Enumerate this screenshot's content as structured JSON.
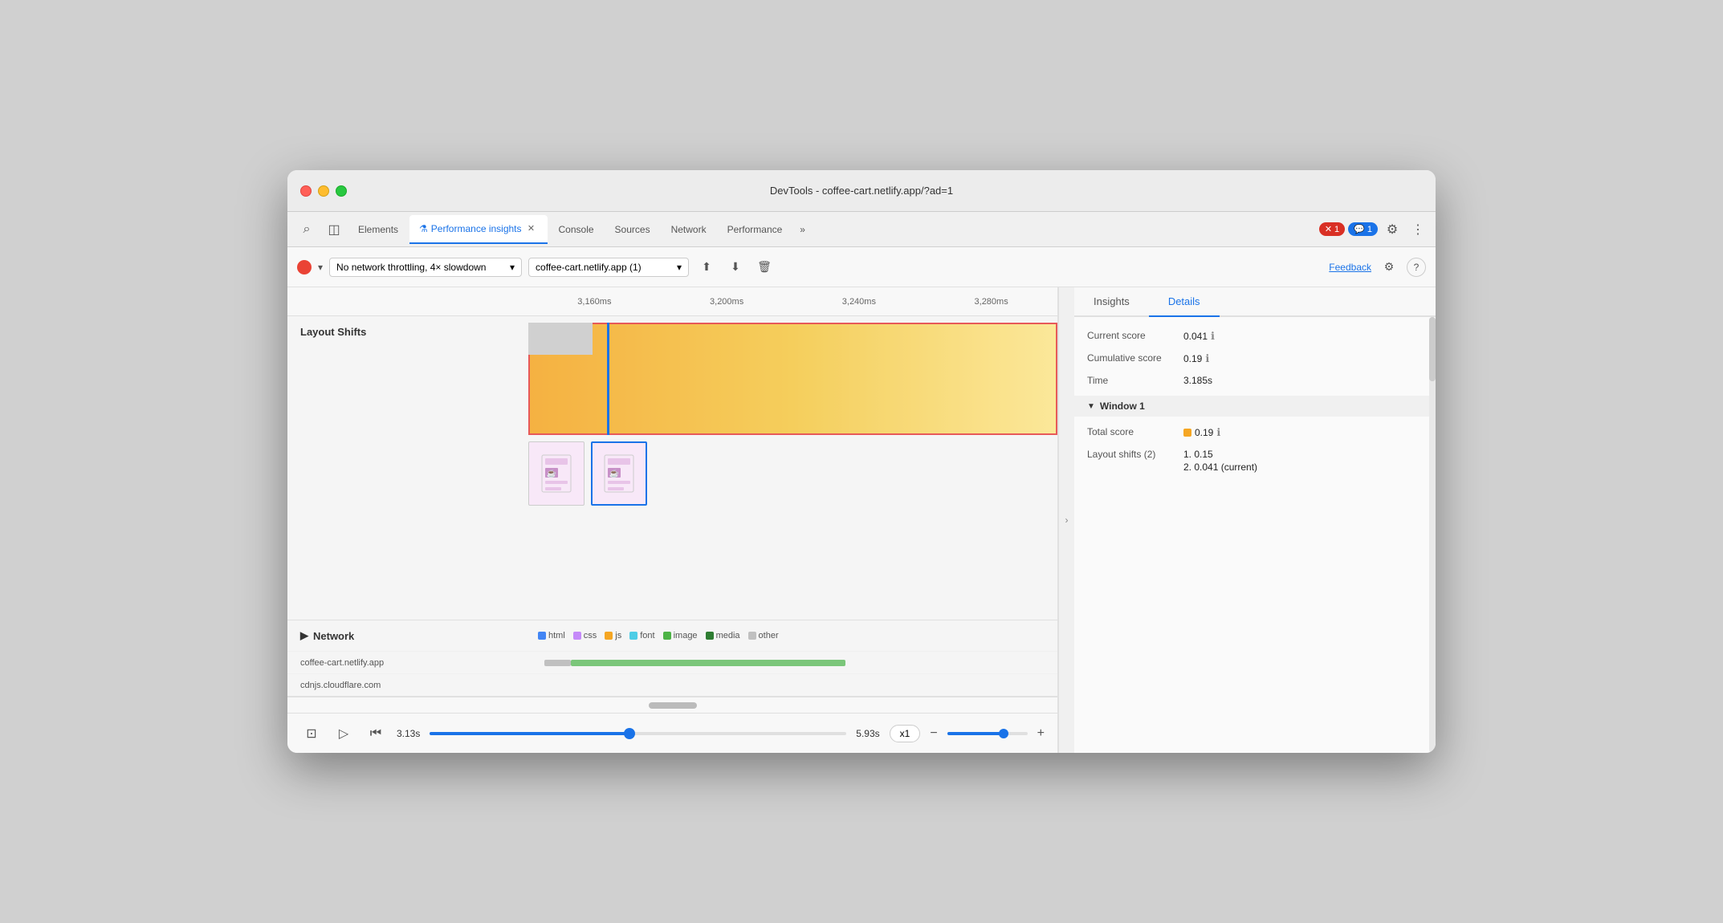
{
  "window": {
    "title": "DevTools - coffee-cart.netlify.app/?ad=1"
  },
  "tabs": {
    "items": [
      {
        "label": "Elements",
        "active": false
      },
      {
        "label": "Performance insights",
        "active": true,
        "icon": "⚗",
        "closeable": true
      },
      {
        "label": "Console",
        "active": false
      },
      {
        "label": "Sources",
        "active": false
      },
      {
        "label": "Network",
        "active": false
      },
      {
        "label": "Performance",
        "active": false
      }
    ],
    "more_label": "»",
    "error_count": "1",
    "info_count": "1"
  },
  "toolbar": {
    "record_label": "",
    "throttle_value": "No network throttling, 4× slowdown",
    "origin_value": "coffee-cart.netlify.app (1)",
    "upload_icon": "⬆",
    "download_icon": "⬇",
    "delete_icon": "🗑",
    "feedback_label": "Feedback",
    "settings_icon": "⚙",
    "help_icon": "?"
  },
  "timeline": {
    "markers": [
      "3,160ms",
      "3,200ms",
      "3,240ms",
      "3,280ms"
    ]
  },
  "layout_shifts": {
    "label": "Layout Shifts"
  },
  "network": {
    "label": "Network",
    "legend": [
      {
        "color": "#4285f4",
        "label": "html"
      },
      {
        "color": "#c58af9",
        "label": "css"
      },
      {
        "color": "#f5a623",
        "label": "js"
      },
      {
        "color": "#4ecde6",
        "label": "font"
      },
      {
        "color": "#4db346",
        "label": "image"
      },
      {
        "color": "#2e7d32",
        "label": "media"
      },
      {
        "color": "#c0c0c0",
        "label": "other"
      }
    ],
    "rows": [
      {
        "label": "coffee-cart.netlify.app",
        "bar_left": "8%",
        "bar_width": "52%",
        "bar_color": "#7bc67a",
        "prefix_width": "5%",
        "prefix_color": "#c0c0c0"
      },
      {
        "label": "cdnjs.cloudflare.com",
        "bar_left": "8%",
        "bar_width": "0",
        "bar_color": "#c0c0c0"
      }
    ]
  },
  "playback": {
    "start_time": "3.13s",
    "end_time": "5.93s",
    "speed": "x1",
    "progress": 48
  },
  "right_panel": {
    "tabs": [
      {
        "label": "Insights",
        "active": false
      },
      {
        "label": "Details",
        "active": true
      }
    ],
    "details": {
      "current_score_label": "Current score",
      "current_score_value": "0.041",
      "cumulative_score_label": "Cumulative score",
      "cumulative_score_value": "0.19",
      "time_label": "Time",
      "time_value": "3.185s"
    },
    "window1": {
      "label": "Window 1",
      "total_score_label": "Total score",
      "total_score_value": "0.19",
      "layout_shifts_label": "Layout shifts (2)",
      "shift1": "1. 0.15",
      "shift2": "2. 0.041 (current)"
    }
  }
}
